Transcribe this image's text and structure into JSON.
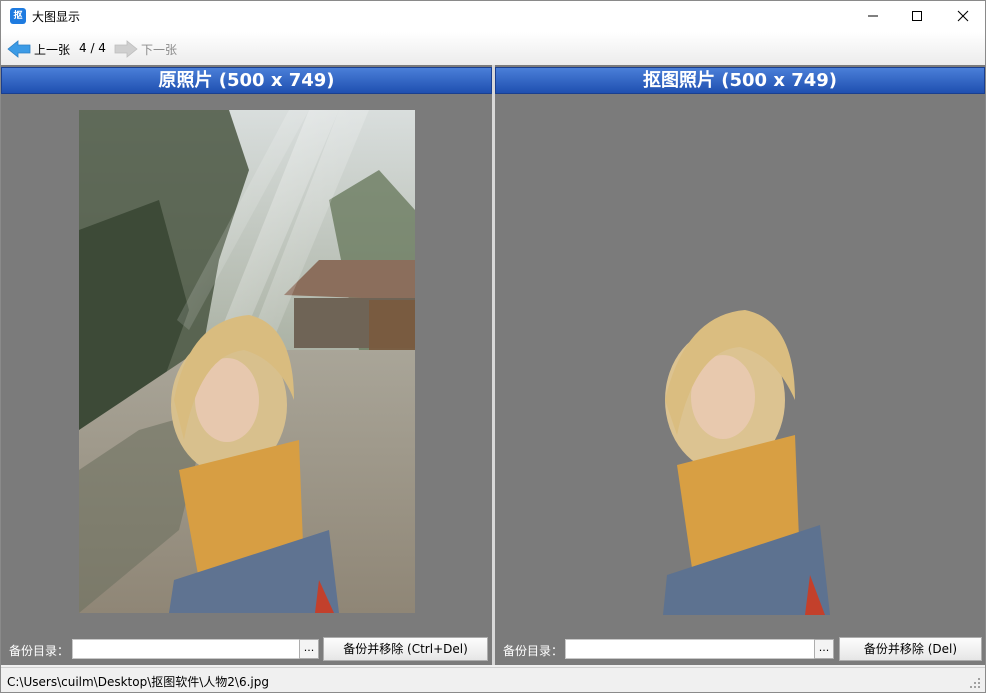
{
  "window": {
    "title": "大图显示",
    "app_icon_text": "抠"
  },
  "toolbar": {
    "prev_label": "上一张",
    "counter": "4 / 4",
    "next_label": "下一张"
  },
  "left_panel": {
    "header": "原照片 (500 x 749)",
    "backup_label": "备份目录：",
    "backup_value": "",
    "browse_label": "...",
    "action_label": "备份并移除 (Ctrl+Del)"
  },
  "right_panel": {
    "header": "抠图照片 (500 x 749)",
    "backup_label": "备份目录：",
    "backup_value": "",
    "browse_label": "...",
    "action_label": "备份并移除 (Del)"
  },
  "status": {
    "path": "C:\\Users\\cuilm\\Desktop\\抠图软件\\人物2\\6.jpg"
  },
  "icons": {
    "app": "scissors-app-icon",
    "prev": "arrow-left-icon",
    "next": "arrow-right-icon",
    "minimize": "minimize-icon",
    "maximize": "maximize-icon",
    "close": "close-icon",
    "grip": "resize-grip-icon"
  },
  "colors": {
    "panel_bg": "#7b7b7b",
    "header_top": "#4a7fd8",
    "header_bottom": "#1f4fb0",
    "arrow_active": "#3c9be6",
    "arrow_disabled": "#c8c8c8"
  }
}
